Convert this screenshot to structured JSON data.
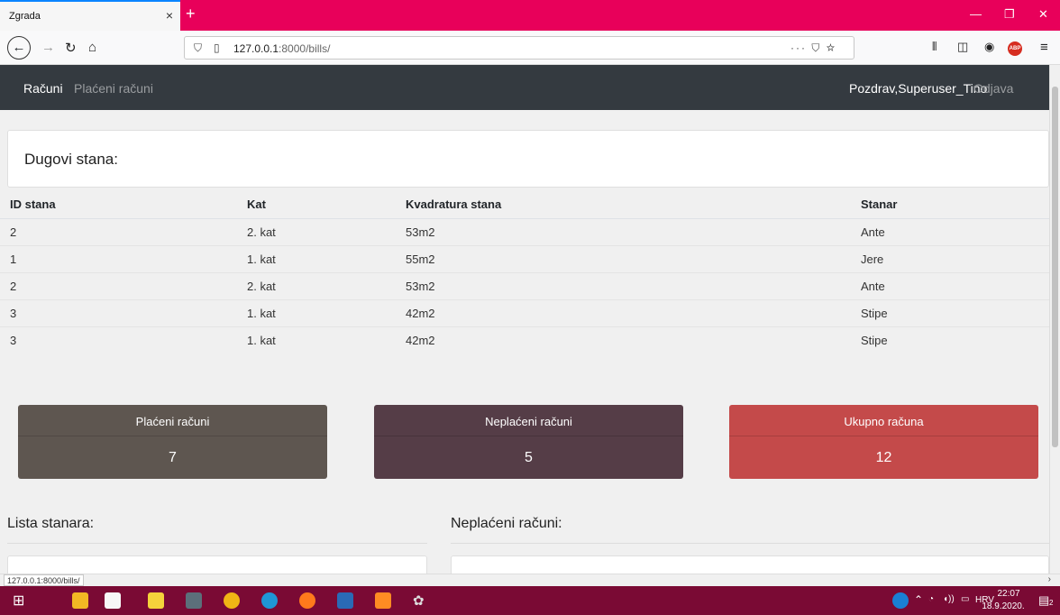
{
  "browser": {
    "tab_title": "Zgrada",
    "tab_close": "×",
    "new_tab": "+",
    "url_host": "127.0.0.1",
    "url_path": ":8000/bills/",
    "page_actions": "··· ⛉ ☆",
    "status_url": "127.0.0.1:8000/bills/"
  },
  "navbar": {
    "items": [
      {
        "label": "Računi"
      },
      {
        "label": "Plaćeni računi"
      }
    ],
    "greeting": "Pozdrav,Superuser_Tino",
    "logout": "Odjava"
  },
  "debts": {
    "title": "Dugovi stana:",
    "columns": [
      "ID stana",
      "Kat",
      "Kvadratura stana",
      "Stanar"
    ],
    "rows": [
      [
        "2",
        "2. kat",
        "53m2",
        "Ante"
      ],
      [
        "1",
        "1. kat",
        "55m2",
        "Jere"
      ],
      [
        "2",
        "2. kat",
        "53m2",
        "Ante"
      ],
      [
        "3",
        "1. kat",
        "42m2",
        "Stipe"
      ],
      [
        "3",
        "1. kat",
        "42m2",
        "Stipe"
      ]
    ]
  },
  "stats": [
    {
      "label": "Plaćeni računi",
      "value": "7",
      "color": "#5e5650"
    },
    {
      "label": "Neplaćeni računi",
      "value": "5",
      "color": "#553d47"
    },
    {
      "label": "Ukupno računa",
      "value": "12",
      "color": "#c44a4a"
    }
  ],
  "sections": {
    "tenants_title": "Lista stanara:",
    "unpaid_title": "Neplaćeni računi:"
  },
  "taskbar": {
    "language": "HRV",
    "time": "22:07",
    "date": "18.9.2020.",
    "notifications": "2"
  }
}
